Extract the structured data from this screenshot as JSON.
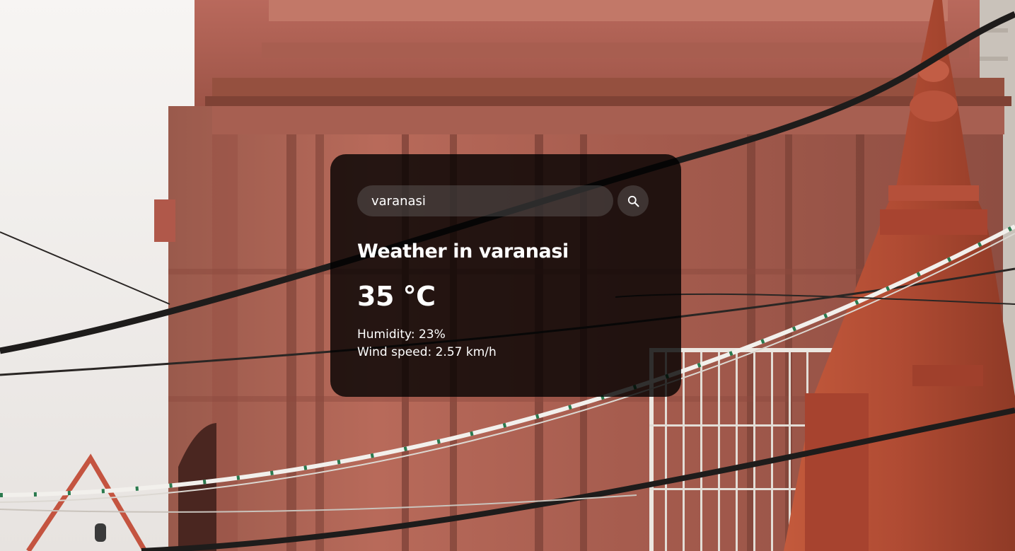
{
  "search": {
    "value": "varanasi"
  },
  "weather": {
    "title": "Weather in varanasi",
    "temperature": "35 °C",
    "humidity": "Humidity: 23%",
    "wind": "Wind speed: 2.57 km/h"
  },
  "icons": {
    "search": "search-icon"
  },
  "colors": {
    "card_background": "#000000cc",
    "text": "#ffffff",
    "temple_red": "#b0503a"
  }
}
